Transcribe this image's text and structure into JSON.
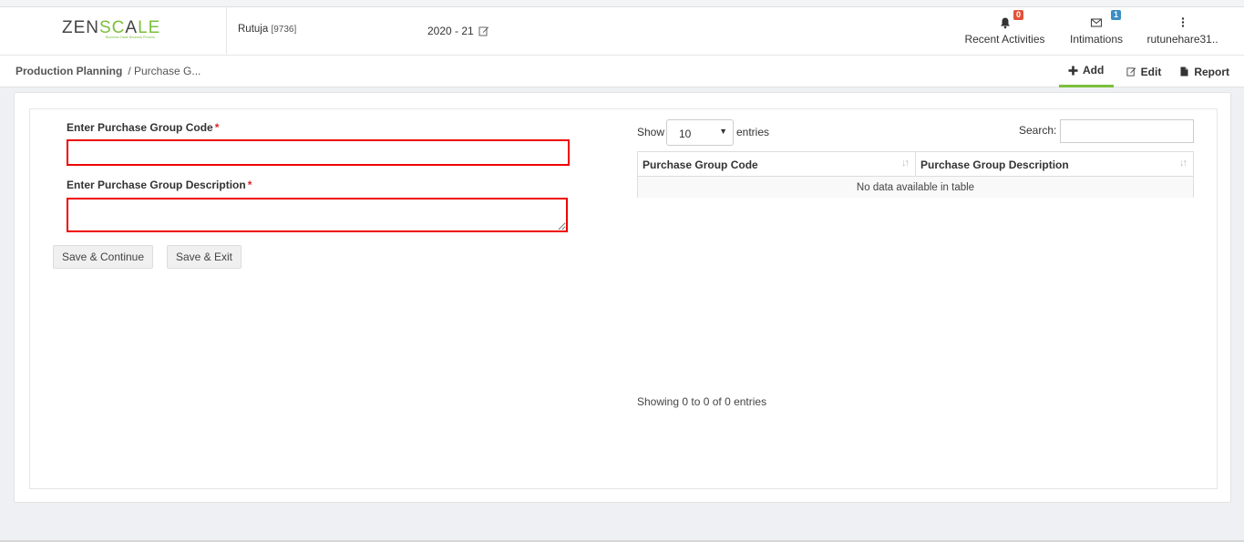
{
  "header": {
    "logo_prefix": "ZEN",
    "logo_accent": "SC",
    "logo_mid": "A",
    "logo_suffix": "LE",
    "logo_tagline": "Business Grade Business Process",
    "user_name": "Rutuja",
    "user_id": "[9736]",
    "fiscal_year": "2020 - 21",
    "recent_activities": {
      "label": "Recent Activities",
      "count": "0",
      "icon": "bell-icon"
    },
    "intimations": {
      "label": "Intimations",
      "count": "1",
      "icon": "envelope-icon"
    },
    "user_menu": {
      "label": "rutunehare31..",
      "icon": "vertical-dots-icon"
    }
  },
  "breadcrumb": {
    "first": "Production Planning",
    "current": "/ Purchase G..."
  },
  "actions": {
    "add": "Add",
    "edit": "Edit",
    "report": "Report"
  },
  "form": {
    "code_label": "Enter Purchase Group Code",
    "code_value": "",
    "description_label": "Enter Purchase Group Description",
    "description_value": "",
    "required_mark": "*",
    "save_continue": "Save & Continue",
    "save_exit": "Save & Exit"
  },
  "datatable": {
    "show_label": "Show",
    "page_size": "10",
    "entries_label": "entries",
    "search_label": "Search:",
    "search_value": "",
    "columns": [
      "Purchase Group Code",
      "Purchase Group Description"
    ],
    "empty_message": "No data available in table",
    "info": "Showing 0 to 0 of 0 entries"
  },
  "colors": {
    "accent": "#7bbf3c",
    "error_border": "#ee0000",
    "badge_red": "#e0533a",
    "badge_blue": "#3a8fc4"
  }
}
